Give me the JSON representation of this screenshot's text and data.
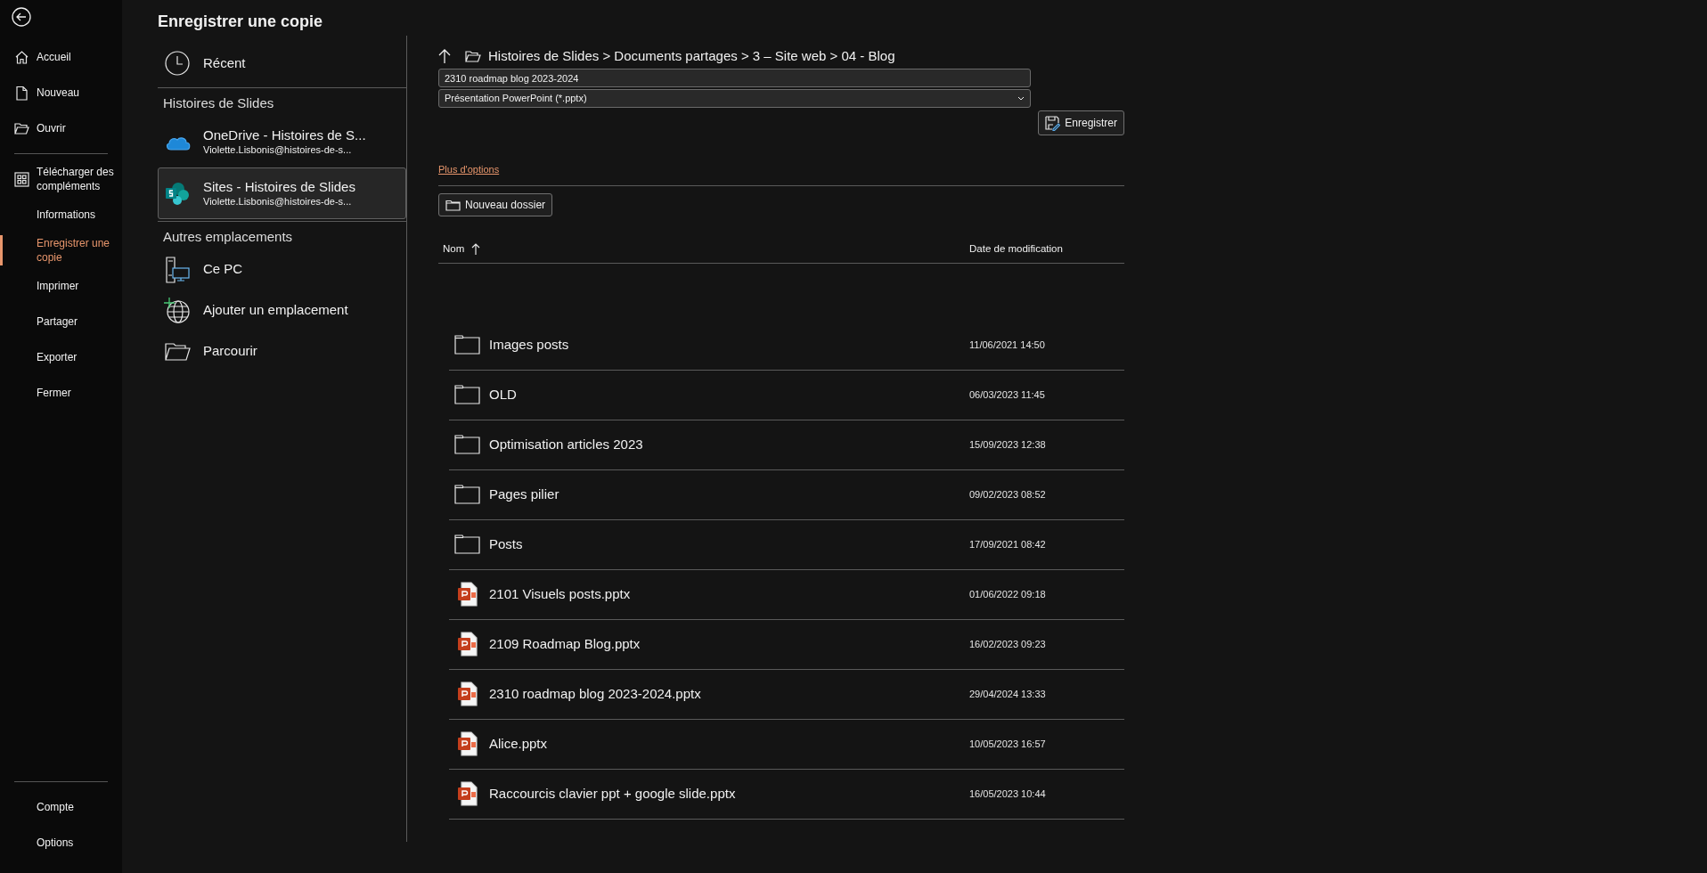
{
  "sidebar": {
    "groups": [
      [
        {
          "label": "Accueil",
          "selected": false
        },
        {
          "label": "Nouveau",
          "selected": false
        },
        {
          "label": "Ouvrir",
          "selected": false
        }
      ],
      [
        {
          "label": "Télécharger des compléments",
          "selected": false
        },
        {
          "label": "Informations",
          "selected": false
        },
        {
          "label": "Enregistrer une copie",
          "selected": true
        },
        {
          "label": "Imprimer",
          "selected": false
        },
        {
          "label": "Partager",
          "selected": false
        },
        {
          "label": "Exporter",
          "selected": false
        },
        {
          "label": "Fermer",
          "selected": false
        }
      ]
    ],
    "bottom_items": [
      {
        "label": "Compte",
        "selected": false
      },
      {
        "label": "Options",
        "selected": false
      }
    ]
  },
  "page_title": "Enregistrer une copie",
  "places": [
    {
      "kind": "recent",
      "title": "Récent"
    },
    {
      "kind": "heading",
      "title": "Histoires de Slides"
    },
    {
      "kind": "cloud",
      "title": "OneDrive - Histoires de S...",
      "subtitle": "Violette.Lisbonis@histoires-de-s...",
      "selected": false
    },
    {
      "kind": "site",
      "title": "Sites - Histoires de Slides",
      "subtitle": "Violette.Lisbonis@histoires-de-s...",
      "selected": true
    },
    {
      "kind": "heading",
      "title": "Autres emplacements"
    },
    {
      "kind": "computer",
      "title": "Ce PC"
    },
    {
      "kind": "network",
      "title": "Ajouter un emplacement"
    },
    {
      "kind": "browse",
      "title": "Parcourir"
    }
  ],
  "breadcrumb": "Histoires de Slides > Documents partages > 3 – Site web > 04 - Blog",
  "file_name": "2310 roadmap blog 2023-2024",
  "file_type": "Présentation PowerPoint (*.pptx)",
  "save_button": "Enregistrer",
  "more_options": "Plus d'options",
  "new_folder_button": "Nouveau dossier",
  "table": {
    "columns": [
      {
        "label": "Nom",
        "sorted": true
      },
      {
        "label": "Date de modification",
        "sorted": false
      }
    ],
    "rows": [
      {
        "kind": "folder",
        "name": "Images posts",
        "date": "11/06/2021 14:50"
      },
      {
        "kind": "folder",
        "name": "OLD",
        "date": "06/03/2023 11:45"
      },
      {
        "kind": "folder",
        "name": "Optimisation articles 2023",
        "date": "15/09/2023 12:38"
      },
      {
        "kind": "folder",
        "name": "Pages pilier",
        "date": "09/02/2023 08:52"
      },
      {
        "kind": "folder",
        "name": "Posts",
        "date": "17/09/2021 08:42"
      },
      {
        "kind": "pptx",
        "name": "2101 Visuels posts.pptx",
        "date": "01/06/2022 09:18"
      },
      {
        "kind": "pptx",
        "name": "2109 Roadmap Blog.pptx",
        "date": "16/02/2023 09:23"
      },
      {
        "kind": "pptx",
        "name": "2310 roadmap blog 2023-2024.pptx",
        "date": "29/04/2024 13:33"
      },
      {
        "kind": "pptx",
        "name": "Alice.pptx",
        "date": "10/05/2023 16:57"
      },
      {
        "kind": "pptx",
        "name": "Raccourcis clavier ppt + google slide.pptx",
        "date": "16/05/2023 10:44"
      }
    ]
  }
}
